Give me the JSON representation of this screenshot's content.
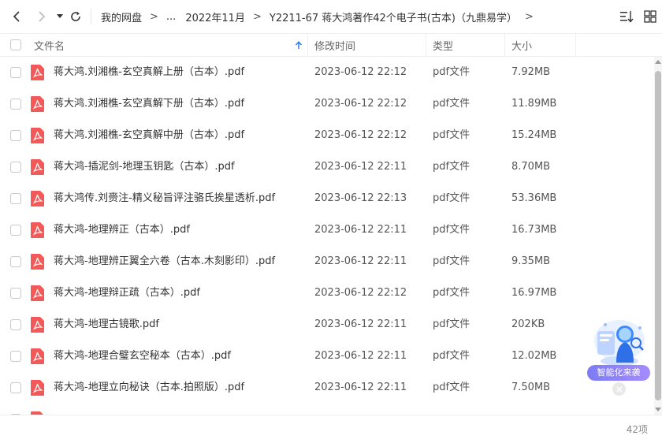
{
  "breadcrumb": [
    {
      "label": "我的网盘"
    },
    {
      "label": "..."
    },
    {
      "label": "2022年11月"
    },
    {
      "label": "Y2211-67 蒋大鸿著作42个电子书(古本)（九鼎易学）"
    }
  ],
  "breadcrumb_sep": ">",
  "columns": {
    "name": "文件名",
    "modified": "修改时间",
    "type": "类型",
    "size": "大小"
  },
  "files": [
    {
      "name": "蒋大鸿.刘湘樵-玄空真解上册（古本）.pdf",
      "modified": "2023-06-12 22:12",
      "type": "pdf文件",
      "size": "7.92MB"
    },
    {
      "name": "蒋大鸿.刘湘樵-玄空真解下册（古本）.pdf",
      "modified": "2023-06-12 22:12",
      "type": "pdf文件",
      "size": "11.89MB"
    },
    {
      "name": "蒋大鸿.刘湘樵-玄空真解中册（古本）.pdf",
      "modified": "2023-06-12 22:12",
      "type": "pdf文件",
      "size": "15.24MB"
    },
    {
      "name": "蒋大鸿-插泥剑-地理玉钥匙（古本）.pdf",
      "modified": "2023-06-12 22:11",
      "type": "pdf文件",
      "size": "8.70MB"
    },
    {
      "name": "蒋大鸿传.刘赍注-精义秘旨评注骆氏挨星透析.pdf",
      "modified": "2023-06-12 22:13",
      "type": "pdf文件",
      "size": "53.36MB"
    },
    {
      "name": "蒋大鸿-地理辨正（古本）.pdf",
      "modified": "2023-06-12 22:11",
      "type": "pdf文件",
      "size": "16.73MB"
    },
    {
      "name": "蒋大鸿-地理辨正翼全六卷（古本.木刻影印）.pdf",
      "modified": "2023-06-12 22:11",
      "type": "pdf文件",
      "size": "9.35MB"
    },
    {
      "name": "蒋大鸿-地理辩正疏（古本）.pdf",
      "modified": "2023-06-12 22:12",
      "type": "pdf文件",
      "size": "16.97MB"
    },
    {
      "name": "蒋大鸿-地理古镜歌.pdf",
      "modified": "2023-06-12 22:11",
      "type": "pdf文件",
      "size": "202KB"
    },
    {
      "name": "蒋大鸿-地理合璧玄空秘本（古本）.pdf",
      "modified": "2023-06-12 22:11",
      "type": "pdf文件",
      "size": "12.02MB"
    },
    {
      "name": "蒋大鸿-地理立向秘诀（古本.拍照版）.pdf",
      "modified": "2023-06-12 22:11",
      "type": "pdf文件",
      "size": "7.50MB"
    },
    {
      "name": "",
      "modified": "",
      "type": "",
      "size": ""
    }
  ],
  "sort": {
    "column": "name",
    "direction": "ascending",
    "icon": "arrow-up-icon"
  },
  "assistant": {
    "label": "智能化来袭"
  },
  "footer": {
    "count": "42项"
  },
  "colors": {
    "pdf_icon": "#f25a5a",
    "accent": "#2b7cf6",
    "text": "#333333",
    "muted": "#666666",
    "border": "#eeeeee"
  }
}
